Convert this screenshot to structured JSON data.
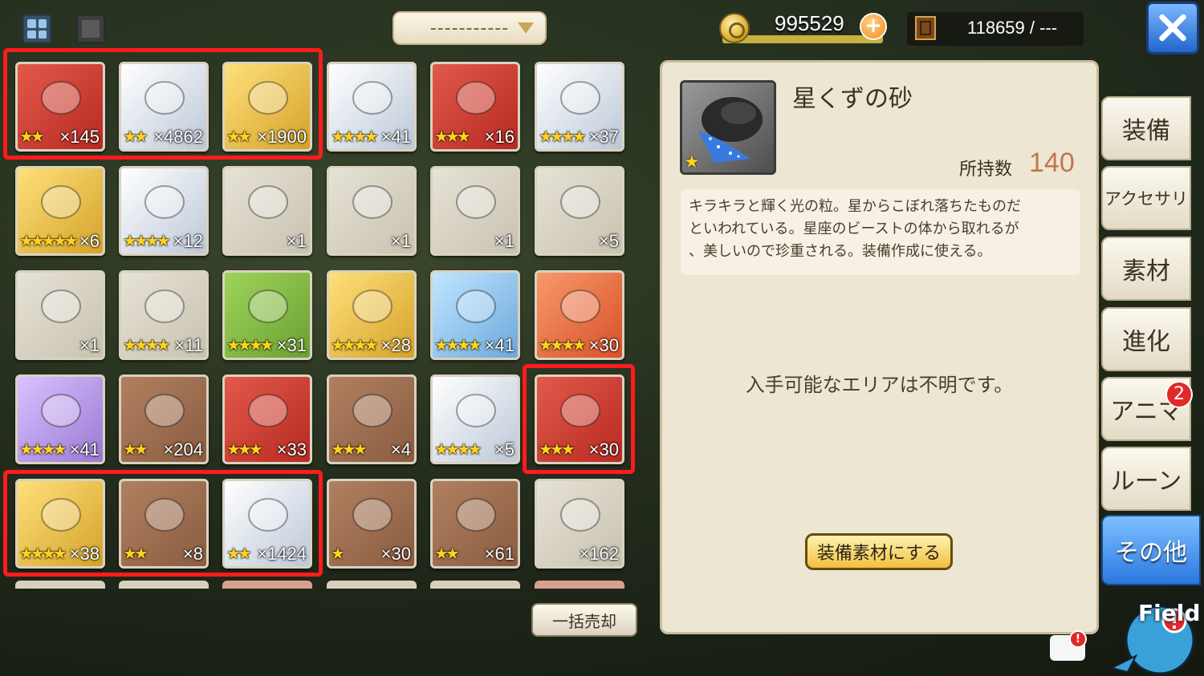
{
  "toolbar": {
    "filter_label": "-----------"
  },
  "currency": {
    "gold": "995529",
    "storage": "118659 / ---"
  },
  "grid": {
    "rows": [
      [
        {
          "stars": "★★",
          "count": "×145",
          "bg": "red",
          "icon": "gold-bar-icon"
        },
        {
          "stars": "★★",
          "count": "×4862",
          "bg": "silver",
          "icon": "gold-bars-icon"
        },
        {
          "stars": "★★",
          "count": "×1900",
          "bg": "gold",
          "icon": "gold-ingot-stack-icon"
        },
        {
          "stars": "★★★★",
          "count": "×41",
          "bg": "silver",
          "icon": "hammer-icon"
        },
        {
          "stars": "★★★",
          "count": "×16",
          "bg": "red",
          "icon": "mallet-icon"
        },
        {
          "stars": "★★★★",
          "count": "×37",
          "bg": "silver",
          "icon": "hammer-icon"
        }
      ],
      [
        {
          "stars": "★★★★★",
          "count": "×6",
          "bg": "gold",
          "icon": "red-crystal-icon"
        },
        {
          "stars": "★★★★",
          "count": "×12",
          "bg": "silver",
          "icon": "red-shard-icon"
        },
        {
          "stars": "",
          "count": "×1",
          "bg": "plain",
          "icon": "gold-ticket-icon"
        },
        {
          "stars": "",
          "count": "×1",
          "bg": "plain",
          "icon": "purple-ticket-icon"
        },
        {
          "stars": "",
          "count": "×1",
          "bg": "plain",
          "icon": "teal-ticket-icon"
        },
        {
          "stars": "",
          "count": "×5",
          "bg": "plain",
          "icon": "galaxy-ticket-icon"
        }
      ],
      [
        {
          "stars": "",
          "count": "×1",
          "bg": "plain",
          "icon": "red-ticket-icon"
        },
        {
          "stars": "★★★★",
          "count": "×11",
          "bg": "plain",
          "icon": "character-bust-icon"
        },
        {
          "stars": "★★★★",
          "count": "×31",
          "bg": "green",
          "icon": "character-bust-icon"
        },
        {
          "stars": "★★★★",
          "count": "×28",
          "bg": "gold",
          "icon": "helmet-bust-icon"
        },
        {
          "stars": "★★★★",
          "count": "×41",
          "bg": "blue",
          "icon": "beast-bust-icon"
        },
        {
          "stars": "★★★★",
          "count": "×30",
          "bg": "orange",
          "icon": "hooded-bust-icon"
        }
      ],
      [
        {
          "stars": "★★★★",
          "count": "×41",
          "bg": "purple",
          "icon": "rabbit-icon"
        },
        {
          "stars": "★★",
          "count": "×204",
          "bg": "bronze",
          "icon": "green-crystal-icon"
        },
        {
          "stars": "★★★",
          "count": "×33",
          "bg": "red",
          "icon": "seeds-icon"
        },
        {
          "stars": "★★★",
          "count": "×4",
          "bg": "bronze",
          "icon": "vegetables-icon"
        },
        {
          "stars": "★★★★",
          "count": "×5",
          "bg": "silver",
          "icon": "blue-vase-icon"
        },
        {
          "stars": "★★★",
          "count": "×30",
          "bg": "red",
          "icon": "orb-ring-icon"
        }
      ],
      [
        {
          "stars": "★★★★",
          "count": "×38",
          "bg": "gold",
          "icon": "orb-ring-icon"
        },
        {
          "stars": "★★",
          "count": "×8",
          "bg": "bronze",
          "icon": "blue-gem-icon"
        },
        {
          "stars": "★★",
          "count": "×1424",
          "bg": "silver",
          "icon": "orb-ring-icon"
        },
        {
          "stars": "★",
          "count": "×30",
          "bg": "bronze",
          "icon": "dark-ore-icon"
        },
        {
          "stars": "★★",
          "count": "×61",
          "bg": "bronze",
          "icon": "dark-ore-icon"
        },
        {
          "stars": "",
          "count": "×162",
          "bg": "plain",
          "icon": "red-orb-icon"
        }
      ]
    ]
  },
  "buttons": {
    "sell_all": "一括売却",
    "make_material": "装備素材にする"
  },
  "detail": {
    "name": "星くずの砂",
    "stars": "★",
    "hold_label": "所持数",
    "hold_value": "140",
    "description_lines": [
      "キラキラと輝く光の粒。星からこぼれ落ちたものだ",
      "といわれている。星座のビーストの体から取れるが",
      "、美しいので珍重される。装備作成に使える。"
    ],
    "area_text": "入手可能なエリアは不明です。"
  },
  "tabs": [
    "装備",
    "アクセサリ",
    "素材",
    "進化",
    "アニマ",
    "ルーン",
    "その他"
  ],
  "tab_badge": "2",
  "field_label": "Field",
  "chat_alert": "!",
  "colors": {
    "highlight": "#ff1c1c",
    "active_tab": "#2b78e0",
    "hold_value": "#c0784a"
  }
}
